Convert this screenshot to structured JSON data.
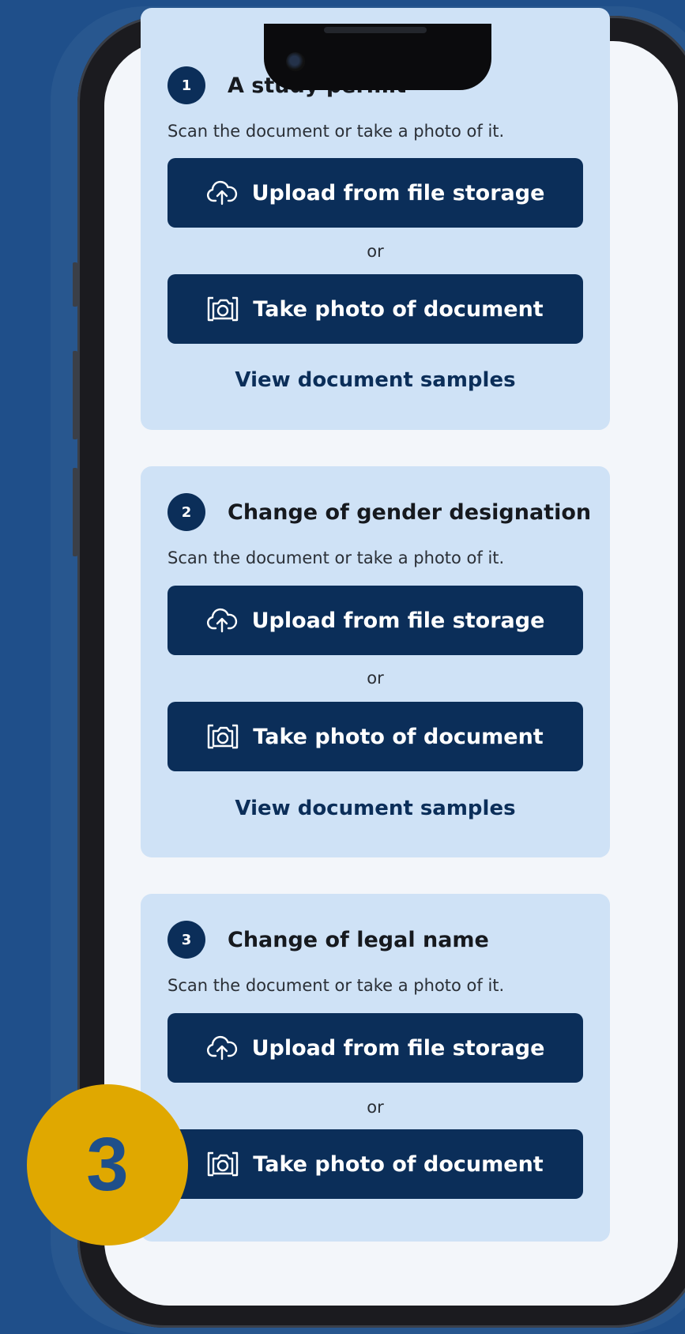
{
  "step_badge": "3",
  "sections": [
    {
      "number": "1",
      "title": "A study permit",
      "description": "Scan the document or take a photo of it.",
      "upload_label": "Upload from file storage",
      "or_label": "or",
      "photo_label": "Take photo of document",
      "samples_link": "View document samples"
    },
    {
      "number": "2",
      "title": "Change of gender designation",
      "description": "Scan the document or take a photo of it.",
      "upload_label": "Upload from file storage",
      "or_label": "or",
      "photo_label": "Take photo of document",
      "samples_link": "View document samples"
    },
    {
      "number": "3",
      "title": "Change of legal name",
      "description": "Scan the document or take a photo of it.",
      "upload_label": "Upload from file storage",
      "or_label": "or",
      "photo_label": "Take photo of document"
    }
  ],
  "icons": {
    "upload": "cloud-upload-icon",
    "photo": "camera-icon"
  },
  "colors": {
    "background": "#1f4f8a",
    "card": "#cfe2f6",
    "button": "#0b2e59",
    "badge": "#e0a800"
  }
}
